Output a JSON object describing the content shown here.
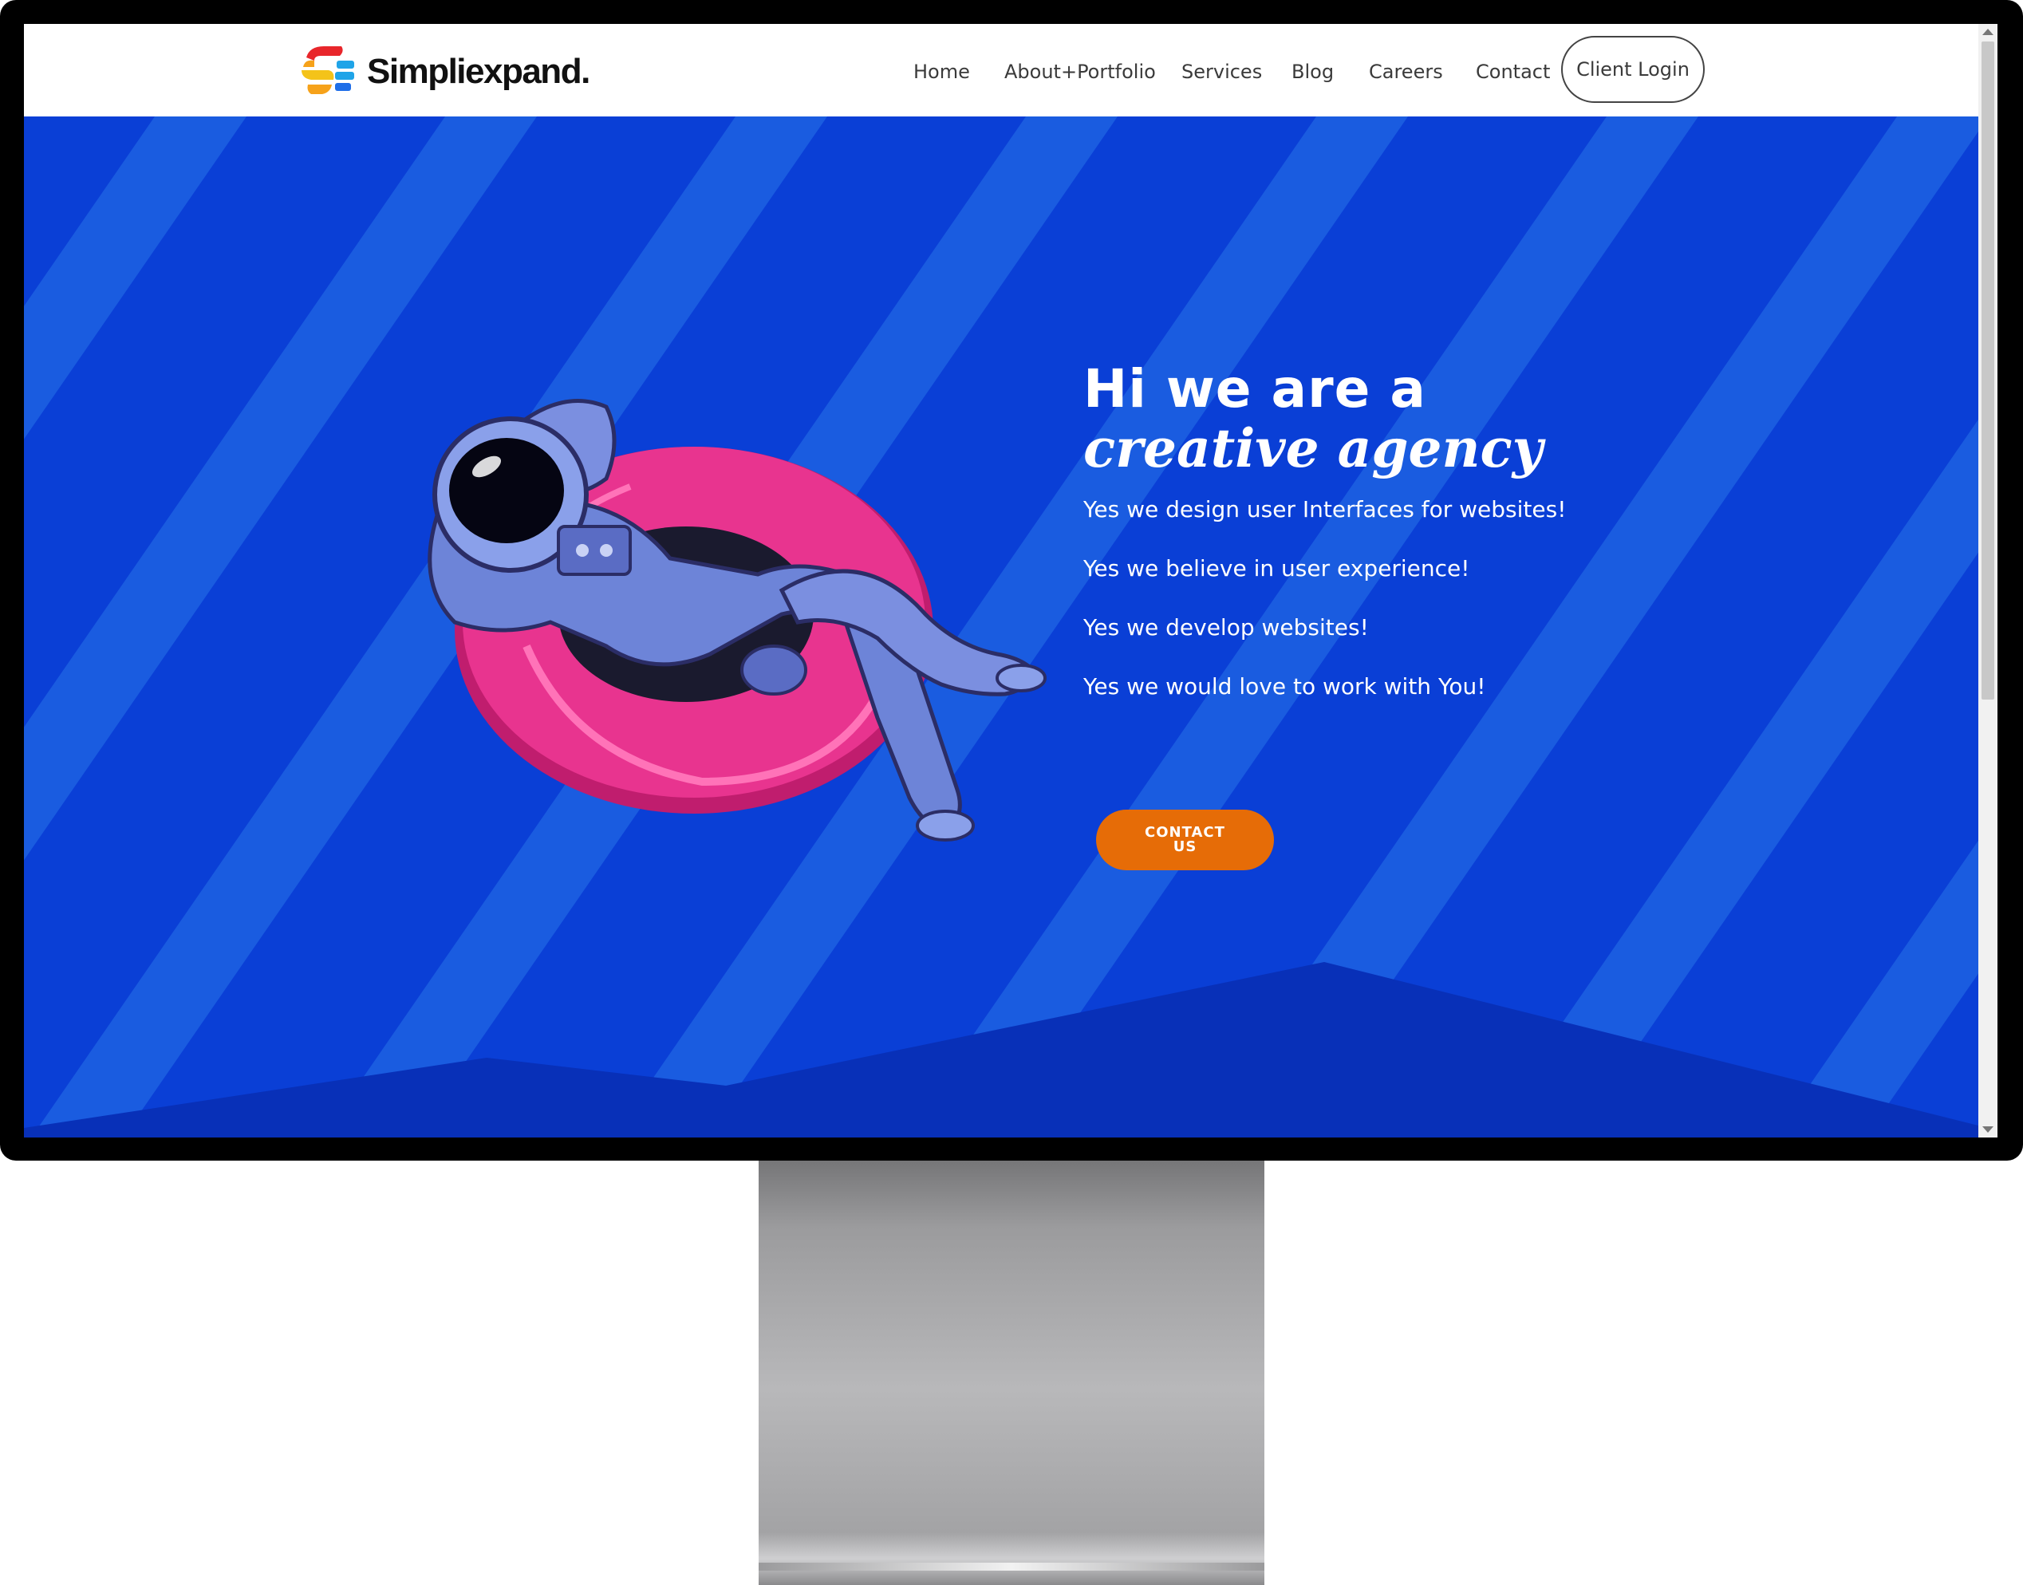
{
  "site": {
    "logo_text": "Simpliexpand.",
    "colors": {
      "hero_bg": "#0a3fd6",
      "stripe": "#1a5ce0",
      "mountain": "#0830b8",
      "cta": "#e66c07",
      "float_ring": "#e8348f"
    }
  },
  "nav": {
    "items": [
      "Home",
      "About+Portfolio",
      "Services",
      "Blog",
      "Careers",
      "Contact"
    ],
    "login_label": "Client Login"
  },
  "hero": {
    "headline_line1": "Hi we are a",
    "headline_line2": "creative agency",
    "lines": [
      "Yes we design user Interfaces for websites!",
      "Yes we believe in user experience!",
      "Yes we develop websites!",
      "Yes we would love to work with You!"
    ],
    "cta_label": "CONTACT US",
    "illustration": "astronaut-on-float-illustration"
  }
}
